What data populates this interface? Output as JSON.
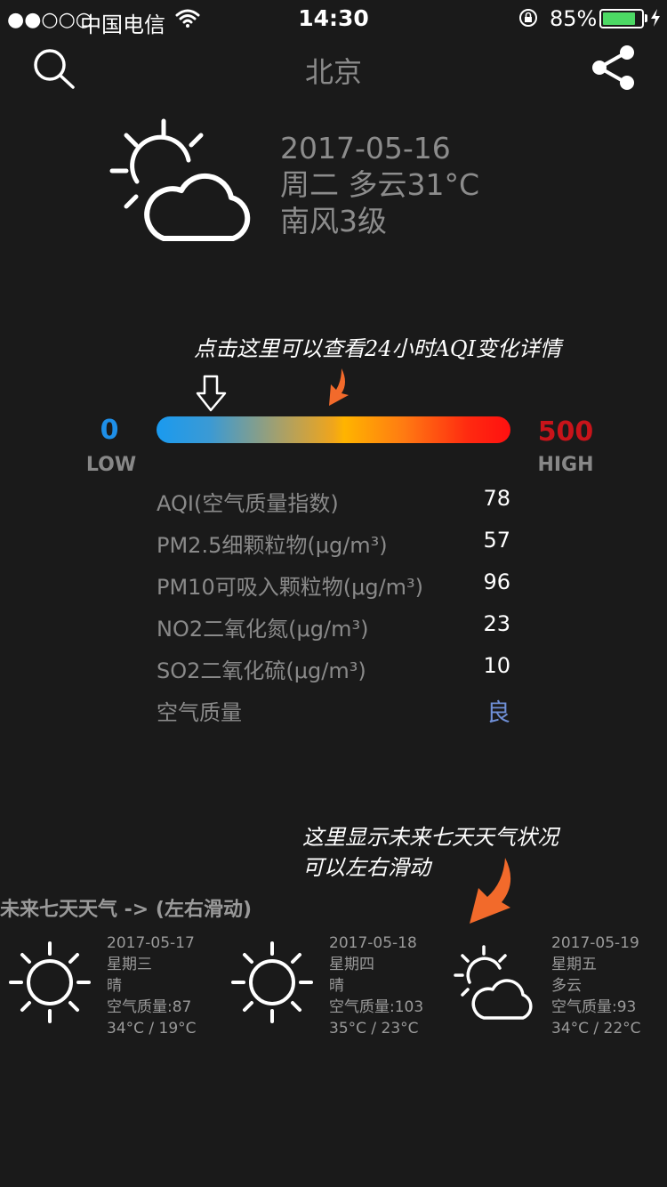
{
  "status_bar": {
    "signal": "●●○○○",
    "carrier": "中国电信",
    "time": "14:30",
    "battery_percent": "85%",
    "battery_level": 0.85,
    "battery_color": "#4cd964"
  },
  "nav": {
    "title": "北京",
    "search_icon": "search-icon",
    "share_icon": "share-icon"
  },
  "current": {
    "icon": "partly-cloudy-icon",
    "date": "2017-05-16",
    "summary": "周二 多云31°C",
    "wind": "南风3级"
  },
  "aqi_hint": "点击这里可以查看24小时AQI变化详情",
  "aqi_scale": {
    "min": "0",
    "max": "500",
    "low_label": "LOW",
    "high_label": "HIGH",
    "current_value": 78,
    "min_color": "#1e8fe8",
    "max_color": "#c8141a"
  },
  "aqi_rows": [
    {
      "label": "AQI(空气质量指数)",
      "value": "78"
    },
    {
      "label": "PM2.5细颗粒物(μg/m³)",
      "value": "57"
    },
    {
      "label": "PM10可吸入颗粒物(μg/m³)",
      "value": "96"
    },
    {
      "label": "NO2二氧化氮(μg/m³)",
      "value": "23"
    },
    {
      "label": "SO2二氧化硫(μg/m³)",
      "value": "10"
    },
    {
      "label": "空气质量",
      "value": "良"
    }
  ],
  "forecast_hint": {
    "line1": "这里显示未来七天天气状况",
    "line2": "可以左右滑动"
  },
  "forecast_title": "未来七天天气 -> (左右滑动)",
  "forecast": [
    {
      "icon": "sun-icon",
      "date": "2017-05-17",
      "weekday": "星期三",
      "weather": "晴",
      "aqi": "空气质量:87",
      "temp": "34°C / 19°C"
    },
    {
      "icon": "sun-icon",
      "date": "2017-05-18",
      "weekday": "星期四",
      "weather": "晴",
      "aqi": "空气质量:103",
      "temp": "35°C / 23°C"
    },
    {
      "icon": "partly-cloudy-icon",
      "date": "2017-05-19",
      "weekday": "星期五",
      "weather": "多云",
      "aqi": "空气质量:93",
      "temp": "34°C / 22°C"
    }
  ]
}
